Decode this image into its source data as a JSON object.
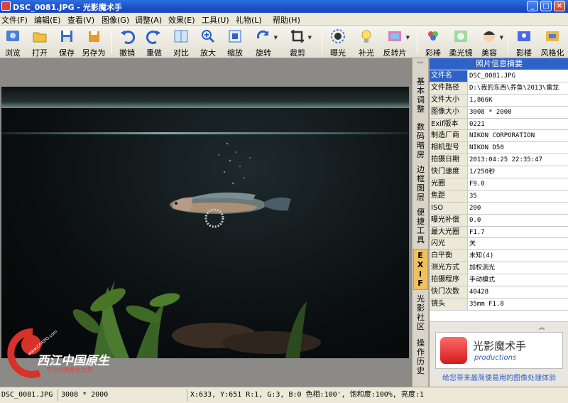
{
  "window": {
    "title": "DSC_0081.JPG - 光影魔术手",
    "buttons": [
      "_",
      "□",
      "×"
    ]
  },
  "menu": [
    "文件(F)",
    "编辑(E)",
    "查看(V)",
    "图像(G)",
    "调整(A)",
    "效果(E)",
    "工具(U)",
    "礼物(L)",
    "帮助(H)"
  ],
  "toolbar": {
    "items": [
      "浏览",
      "打开",
      "保存",
      "另存为",
      "撤销",
      "重做",
      "对比",
      "放大",
      "缩放",
      "旋转",
      "裁剪",
      "曝光",
      "补光",
      "反转片",
      "彩棒",
      "柔光镜",
      "美容",
      "影楼",
      "风格化"
    ]
  },
  "sidetabs": {
    "arrows": "»»",
    "items": [
      "基本调整",
      "数码暗房",
      "边框图层",
      "便捷工具",
      "EXIF",
      "光影社区",
      "操作历史"
    ],
    "active": "EXIF"
  },
  "info_panel": {
    "title": "照片信息摘要",
    "rows": [
      {
        "k": "文件名",
        "v": "DSC_0081.JPG"
      },
      {
        "k": "文件路径",
        "v": "D:\\我的东西\\养鱼\\2013\\雷龙"
      },
      {
        "k": "文件大小",
        "v": "1,866K"
      },
      {
        "k": "图像大小",
        "v": "3008 * 2000"
      },
      {
        "k": "Exif版本",
        "v": "0221"
      },
      {
        "k": "制造厂商",
        "v": "NIKON CORPORATION"
      },
      {
        "k": "相机型号",
        "v": "NIKON D50"
      },
      {
        "k": "拍摄日期",
        "v": "2013:04:25 22:35:47"
      },
      {
        "k": "快门速度",
        "v": "1/250秒"
      },
      {
        "k": "光圈",
        "v": "F9.0"
      },
      {
        "k": "焦距",
        "v": "35"
      },
      {
        "k": "ISO",
        "v": "200"
      },
      {
        "k": "曝光补偿",
        "v": "0.0"
      },
      {
        "k": "最大光圈",
        "v": "F1.7"
      },
      {
        "k": "闪光",
        "v": "关"
      },
      {
        "k": "白平衡",
        "v": "未知(4)"
      },
      {
        "k": "测光方式",
        "v": "加权测光"
      },
      {
        "k": "拍摄程序",
        "v": "手动模式"
      },
      {
        "k": "快门次数",
        "v": "40428"
      },
      {
        "k": "镜头",
        "v": "35mm F1.8"
      }
    ],
    "selected_row": "文件名",
    "ad": {
      "title": "光影魔术手",
      "subtitle": "productions",
      "tagline": "给您带来最简便易用的图像处理体验",
      "collapse": "︽"
    }
  },
  "statusbar": {
    "filename": "DSC_0081.JPG",
    "size": "3008 * 2000",
    "pixel": "X:633, Y:651 R:1, G:3, B:0 色相:100', 饱和度:100%, 亮度:1"
  },
  "watermark": {
    "text": "西江中国原生",
    "subtext": "守望中国原生之美",
    "url": "www.CORPO.com"
  },
  "colors": {
    "titlebar": "#1d4fc9",
    "accent": "#2f62c8",
    "active_tab": "#f2c15a",
    "photo_bg": "#0a0c0e"
  }
}
